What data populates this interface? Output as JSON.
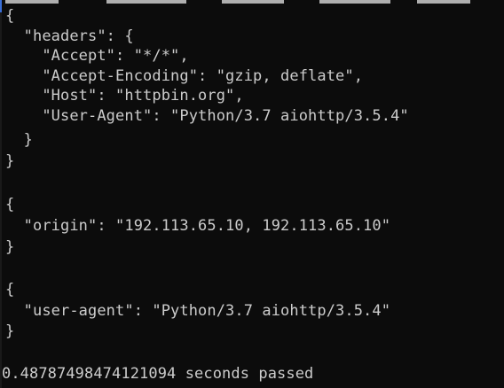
{
  "terminal": {
    "lines": [
      "{",
      "  \"headers\": {",
      "    \"Accept\": \"*/*\",",
      "    \"Accept-Encoding\": \"gzip, deflate\",",
      "    \"Host\": \"httpbin.org\",",
      "    \"User-Agent\": \"Python/3.7 aiohttp/3.5.4\"",
      "  }",
      "}",
      "",
      "{",
      "  \"origin\": \"192.113.65.10, 192.113.65.10\"",
      "}",
      "",
      "{",
      "  \"user-agent\": \"Python/3.7 aiohttp/3.5.4\"",
      "}",
      "",
      "0.48787498474121094 seconds passed"
    ]
  },
  "colors": {
    "background": "#0c0c0c",
    "text": "#cccccc",
    "edge_accent": "#3a6fd8"
  }
}
